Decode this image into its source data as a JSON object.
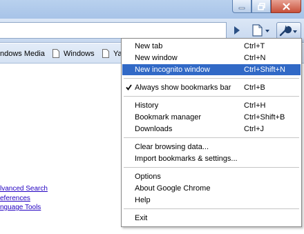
{
  "window": {
    "buttons": [
      {
        "name": "minimize-button",
        "icon": "minimize-icon"
      },
      {
        "name": "restore-button",
        "icon": "restore-icon"
      },
      {
        "name": "close-button",
        "icon": "close-icon"
      }
    ]
  },
  "toolbar": {
    "go_icon": "play-icon",
    "page_icon": "page-menu-icon",
    "wrench_icon": "wrench-icon"
  },
  "bookmarks": [
    {
      "label": "ndows Media"
    },
    {
      "label": "Windows"
    },
    {
      "label": "Ya"
    }
  ],
  "page_links": [
    "lvanced Search",
    "eferences",
    "nguage Tools"
  ],
  "menu": {
    "items": [
      {
        "label": "New tab",
        "shortcut": "Ctrl+T"
      },
      {
        "label": "New window",
        "shortcut": "Ctrl+N"
      },
      {
        "label": "New incognito window",
        "shortcut": "Ctrl+Shift+N",
        "highlighted": true
      },
      {
        "label": "Always show bookmarks bar",
        "shortcut": "Ctrl+B",
        "checked": true
      },
      {
        "label": "History",
        "shortcut": "Ctrl+H"
      },
      {
        "label": "Bookmark manager",
        "shortcut": "Ctrl+Shift+B"
      },
      {
        "label": "Downloads",
        "shortcut": "Ctrl+J"
      },
      {
        "label": "Clear browsing data...",
        "shortcut": ""
      },
      {
        "label": "Import bookmarks & settings...",
        "shortcut": ""
      },
      {
        "label": "Options",
        "shortcut": ""
      },
      {
        "label": "About Google Chrome",
        "shortcut": ""
      },
      {
        "label": "Help",
        "shortcut": ""
      },
      {
        "label": "Exit",
        "shortcut": ""
      }
    ]
  },
  "colors": {
    "highlight": "#3169c6",
    "link": "#2200c1"
  }
}
